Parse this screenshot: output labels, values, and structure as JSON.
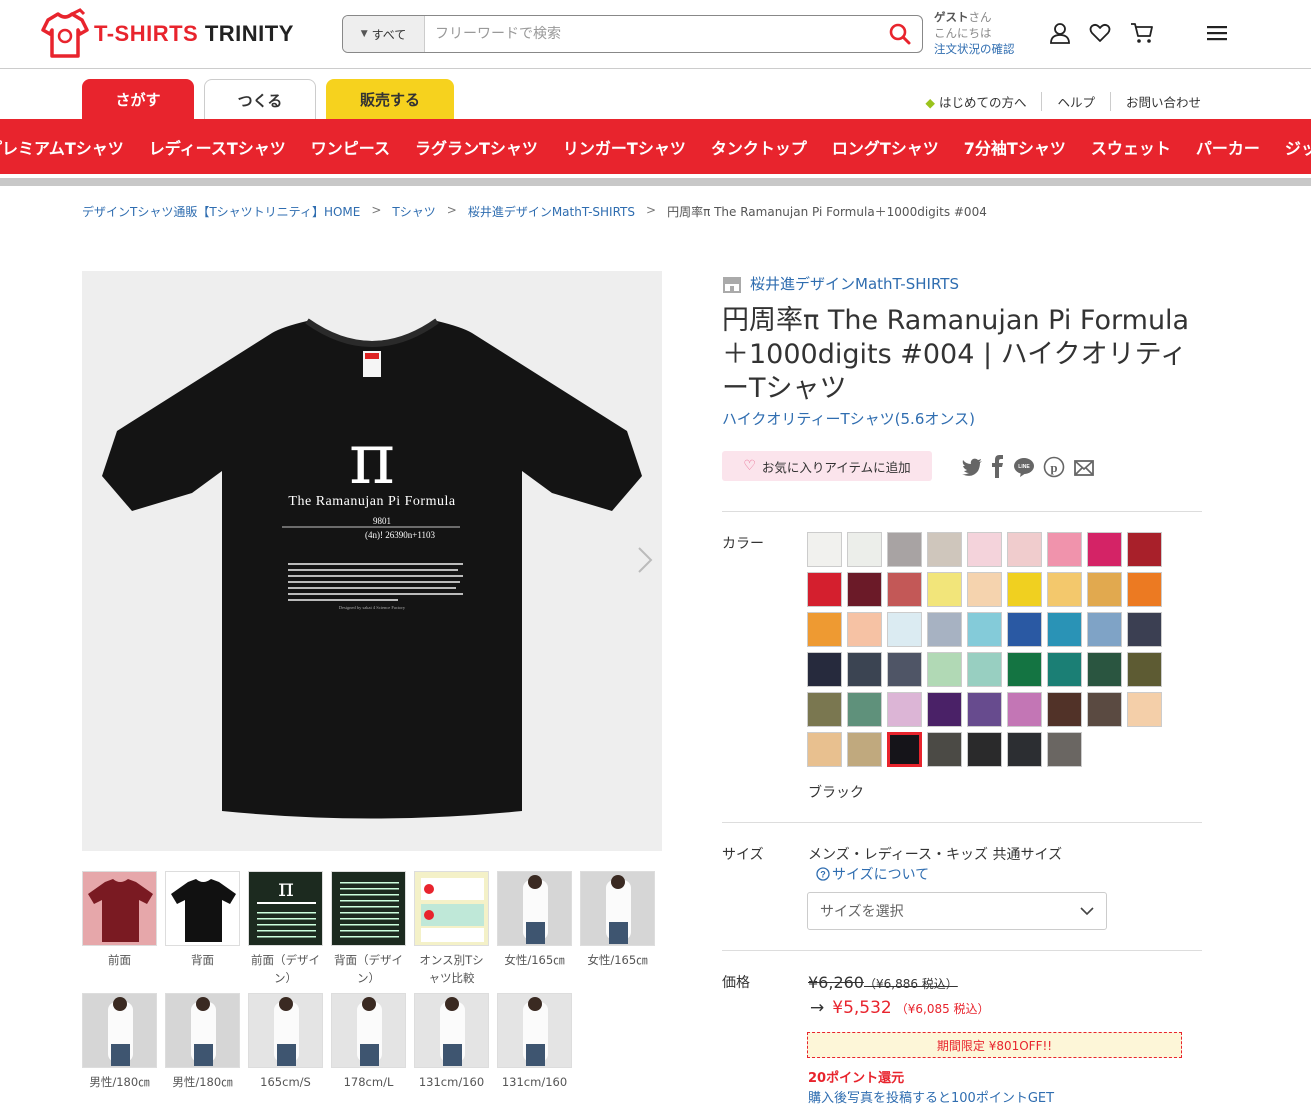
{
  "header": {
    "logo_text_1": "T-SHIRTS",
    "logo_text_2": "TRINITY",
    "search_category": "すべて",
    "search_placeholder": "フリーワードで検索",
    "guest_name": "ゲスト",
    "guest_suffix": "さん",
    "greeting": "こんにちは",
    "order_status": "注文状況の確認"
  },
  "tabs": [
    "さがす",
    "つくる",
    "販売する"
  ],
  "toplinks": [
    "はじめての方へ",
    "ヘルプ",
    "お問い合わせ"
  ],
  "categories": [
    "プレミアムTシャツ",
    "レディースTシャツ",
    "ワンピース",
    "ラグランTシャツ",
    "リンガーTシャツ",
    "タンクトップ",
    "ロングTシャツ",
    "7分袖Tシャツ",
    "スウェット",
    "パーカー",
    "ジップパーカー"
  ],
  "breadcrumb": {
    "home": "デザインTシャツ通販【Tシャツトリニティ】HOME",
    "cat": "Tシャツ",
    "shop": "桜井進デザインMathT-SHIRTS",
    "current": "円周率π The Ramanujan Pi Formula＋1000digits #004"
  },
  "shirt": {
    "symbol": "π",
    "heading": "The Ramanujan Pi Formula",
    "num": "9801",
    "formula": "(4n)!    26390n+1103",
    "caption": "Designed by sakai 4 Science Factory"
  },
  "thumbs": [
    {
      "caption": "前面",
      "bg": "#e6a7aa",
      "shirt": "#7a1a22"
    },
    {
      "caption": "背面",
      "bg": "#ffffff",
      "shirt": "#111111"
    },
    {
      "caption": "前面（デザイン）",
      "bg": "#1c2a1f",
      "shirt": ""
    },
    {
      "caption": "背面（デザイン）",
      "bg": "#1c2a1f",
      "shirt": ""
    },
    {
      "caption": "オンス別Tシャツ比較",
      "bg": "#f4f1c8",
      "shirt": ""
    },
    {
      "caption": "女性/165㎝",
      "bg": "#d6d6d6",
      "shirt": ""
    },
    {
      "caption": "女性/165㎝",
      "bg": "#d6d6d6",
      "shirt": ""
    },
    {
      "caption": "男性/180㎝",
      "bg": "#d6d6d6",
      "shirt": ""
    },
    {
      "caption": "男性/180㎝",
      "bg": "#d6d6d6",
      "shirt": ""
    },
    {
      "caption": "165cm/S",
      "bg": "#e4e4e4",
      "shirt": ""
    },
    {
      "caption": "178cm/L",
      "bg": "#e4e4e4",
      "shirt": ""
    },
    {
      "caption": "131cm/160",
      "bg": "#e4e4e4",
      "shirt": ""
    },
    {
      "caption": "131cm/160",
      "bg": "#e4e4e4",
      "shirt": ""
    }
  ],
  "product": {
    "shop_name": "桜井進デザインMathT-SHIRTS",
    "title": "円周率π The Ramanujan Pi Formula＋1000digits #004 | ハイクオリティーTシャツ",
    "subtitle": "ハイクオリティーTシャツ(5.6オンス)",
    "favorite_label": "お気に入りアイテムに追加",
    "color_label": "カラー",
    "selected_color": "ブラック",
    "size_label": "サイズ",
    "size_note": "メンズ・レディース・キッズ 共通サイズ",
    "size_link": "サイズについて",
    "size_select": "サイズを選択",
    "price_label": "価格",
    "old_price": "¥6,260",
    "old_price_tax": "（¥6,886 税込）",
    "new_price": "¥5,532",
    "new_price_tax": "（¥6,085 税込）",
    "promo": "期間限定 ¥801OFF!!",
    "points": "20ポイント還元",
    "points_link": "購入後写真を投稿すると100ポイントGET"
  },
  "colors": [
    "#f1f1ee",
    "#eceeea",
    "#a8a3a3",
    "#cfc6bc",
    "#f4d3db",
    "#f0cccd",
    "#f093ac",
    "#d42366",
    "#a8202a",
    "#d41f2e",
    "#6b1a28",
    "#c35857",
    "#f2e57a",
    "#f5d3ae",
    "#f0d020",
    "#f3c86c",
    "#e1a94f",
    "#ec7a22",
    "#ee9a32",
    "#f6c2a4",
    "#dbebf2",
    "#a7b2c2",
    "#84cbd9",
    "#2a59a3",
    "#2a93b6",
    "#7fa3c6",
    "#3b3f52",
    "#262a3d",
    "#3b4452",
    "#4f5566",
    "#b1d9b5",
    "#98cfc1",
    "#147442",
    "#1b7f75",
    "#2a5540",
    "#5d5b33",
    "#7a7750",
    "#5f917b",
    "#dcb5d6",
    "#4a2167",
    "#674b8e",
    "#c376b5",
    "#513228",
    "#5a4a41",
    "#f4cfa9",
    "#e8c08f",
    "#c0a97e",
    "#151419",
    "#4b4a45",
    "#2a2a2b",
    "#2c2e32",
    "#6a6662"
  ],
  "selected_color_index": 47
}
